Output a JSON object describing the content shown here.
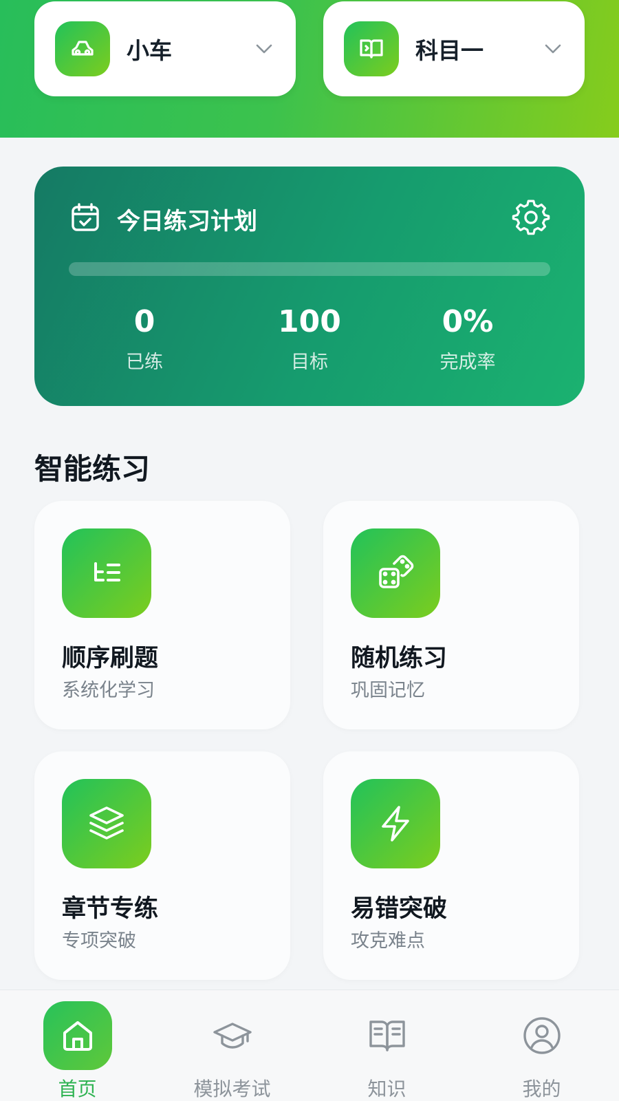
{
  "header": {
    "vehicle_selector": {
      "label": "小车",
      "icon": "car-icon"
    },
    "subject_selector": {
      "label": "科目一",
      "icon": "book-icon"
    }
  },
  "plan": {
    "title": "今日练习计划",
    "progress_fraction": 0,
    "stats": [
      {
        "value": "0",
        "label": "已练"
      },
      {
        "value": "100",
        "label": "目标"
      },
      {
        "value": "0%",
        "label": "完成率"
      }
    ]
  },
  "practice": {
    "section_title": "智能练习",
    "tiles": [
      {
        "title": "顺序刷题",
        "subtitle": "系统化学习",
        "icon": "list-icon"
      },
      {
        "title": "随机练习",
        "subtitle": "巩固记忆",
        "icon": "dice-icon"
      },
      {
        "title": "章节专练",
        "subtitle": "专项突破",
        "icon": "layers-icon"
      },
      {
        "title": "易错突破",
        "subtitle": "攻克难点",
        "icon": "lightning-icon"
      }
    ]
  },
  "bottom_nav": {
    "active_index": 0,
    "items": [
      {
        "label": "首页",
        "icon": "home-icon"
      },
      {
        "label": "模拟考试",
        "icon": "graduation-cap-icon"
      },
      {
        "label": "知识",
        "icon": "open-book-icon"
      },
      {
        "label": "我的",
        "icon": "user-icon"
      }
    ]
  },
  "colors": {
    "brand_green": "#2fb352",
    "plan_card": "#169c6e",
    "header_gradient_end": "#86cc1c"
  }
}
